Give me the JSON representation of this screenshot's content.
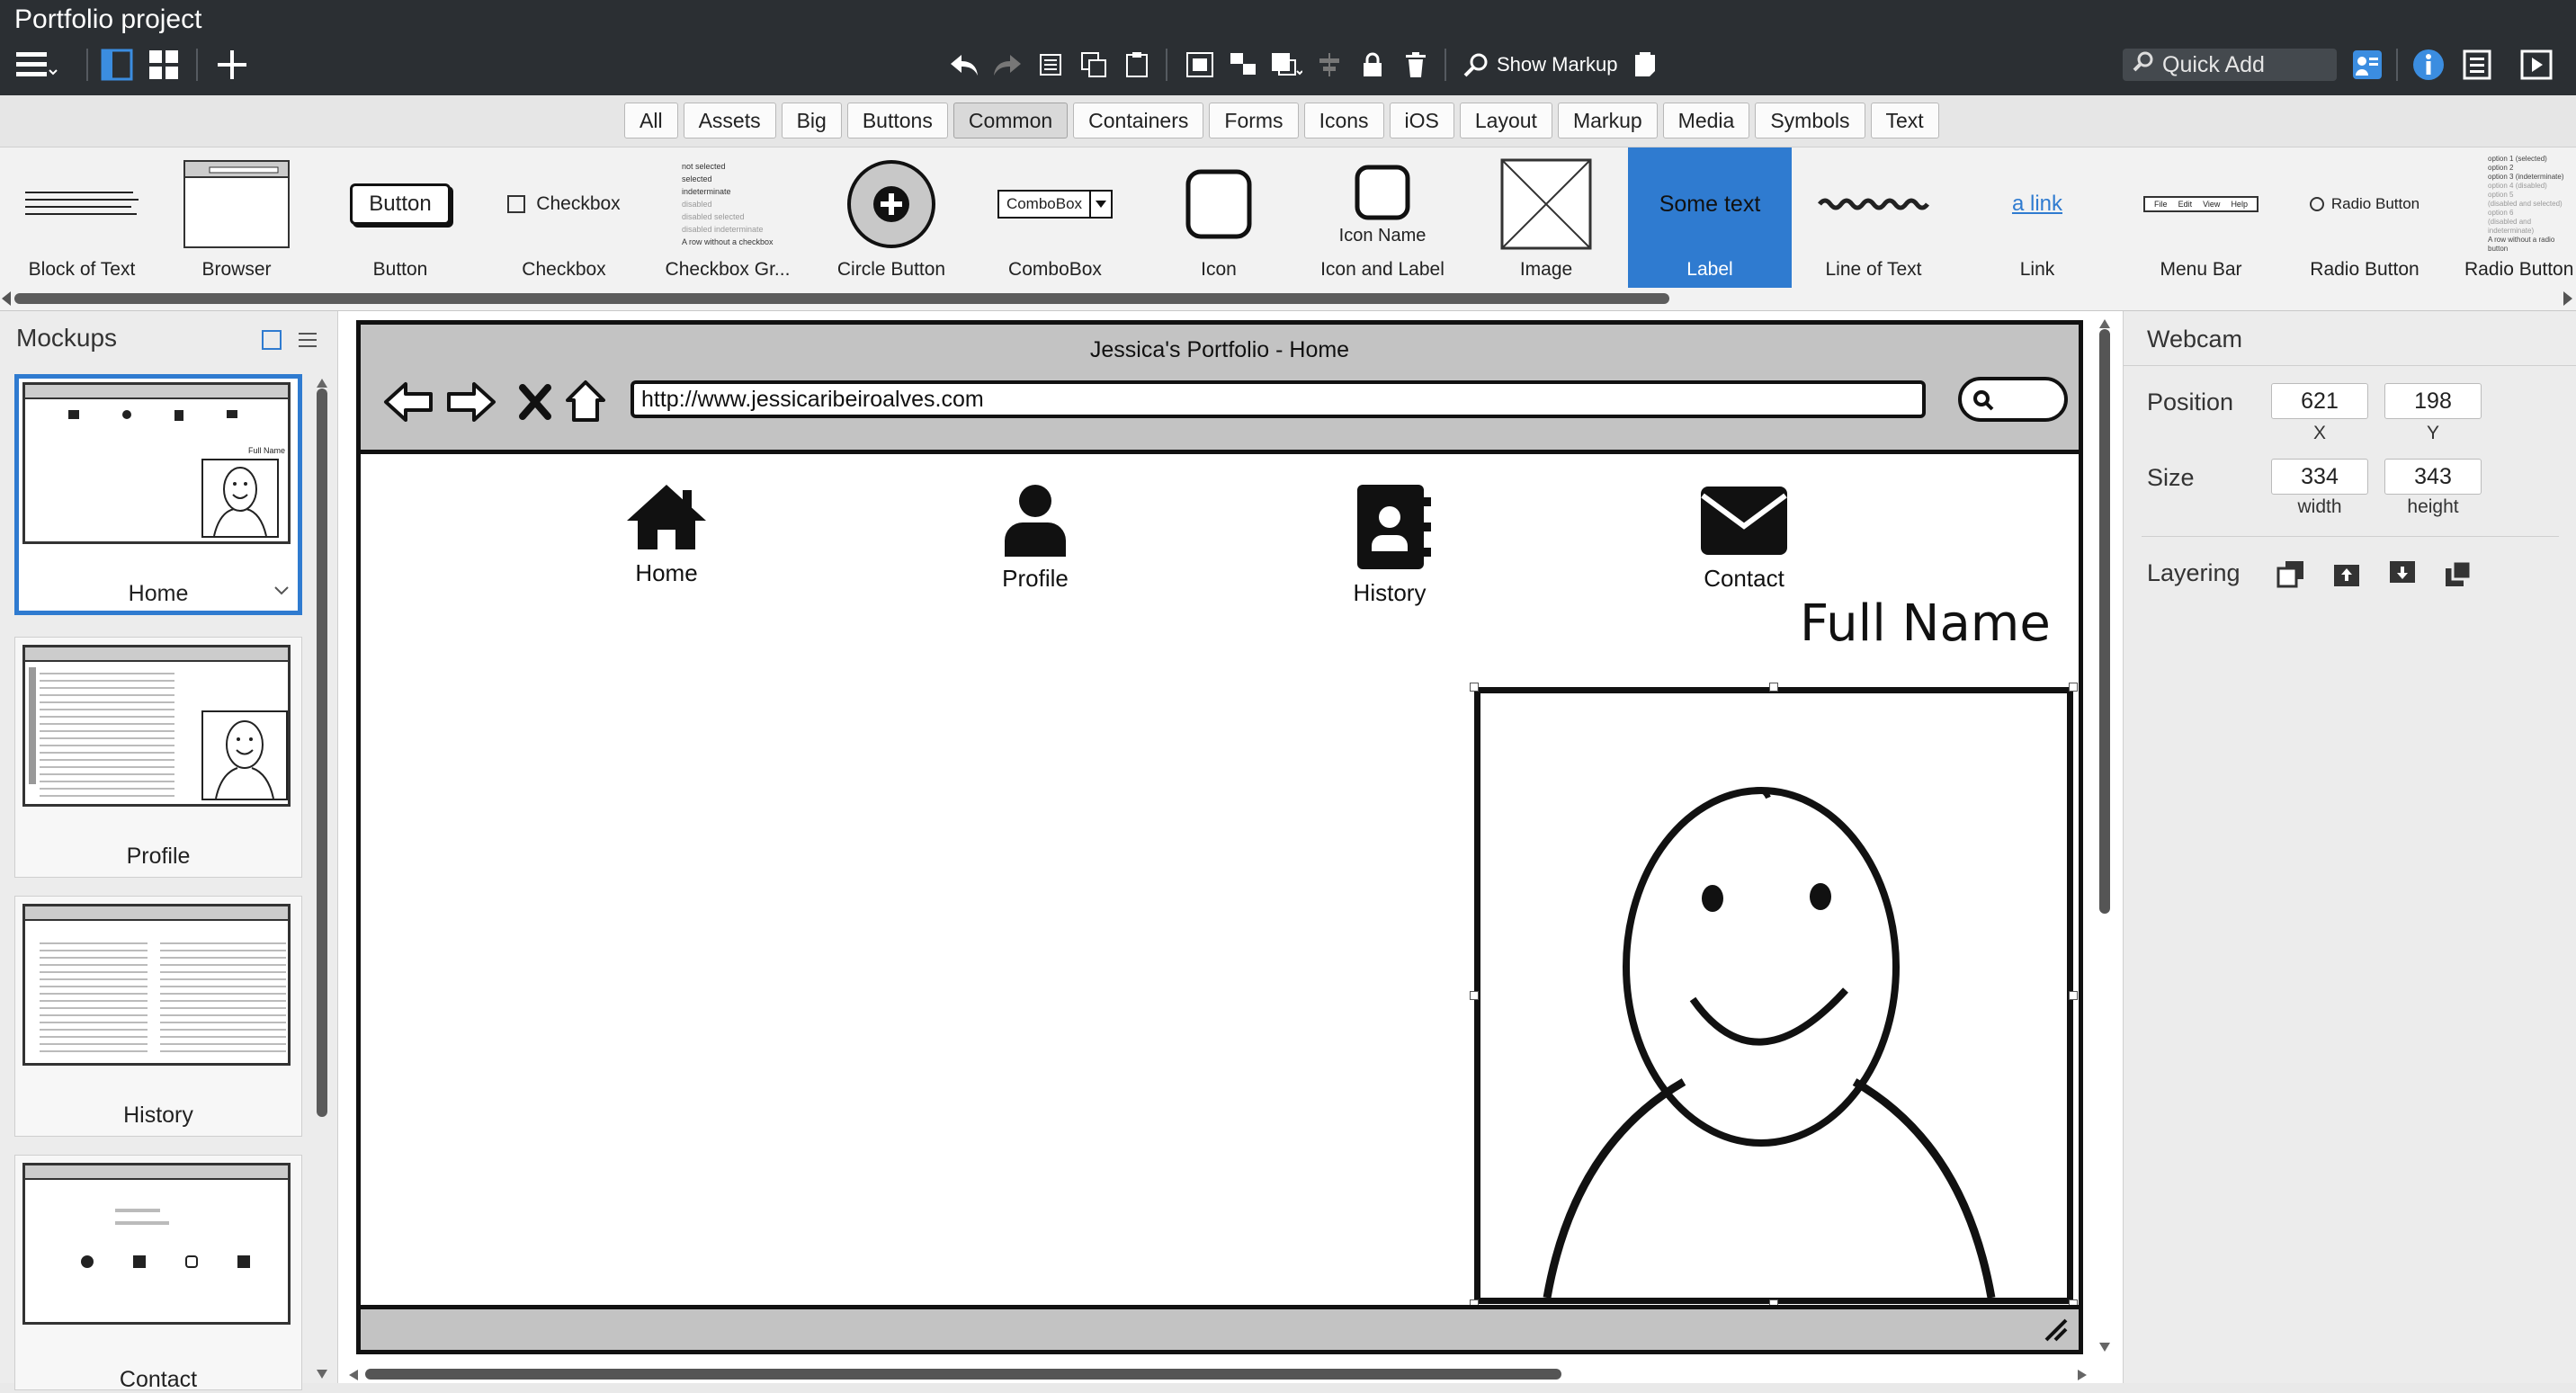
{
  "app": {
    "title": "Portfolio project"
  },
  "toolbar": {
    "show_markup": "Show Markup",
    "quick_add": "Quick Add"
  },
  "filter_tabs": [
    "All",
    "Assets",
    "Big",
    "Buttons",
    "Common",
    "Containers",
    "Forms",
    "Icons",
    "iOS",
    "Layout",
    "Markup",
    "Media",
    "Symbols",
    "Text"
  ],
  "filter_active": "Common",
  "library": {
    "items": [
      "Block of Text",
      "Browser",
      "Button",
      "Checkbox",
      "Checkbox Gr...",
      "Circle Button",
      "ComboBox",
      "Icon",
      "Icon and Label",
      "Image",
      "Label",
      "Line of Text",
      "Link",
      "Menu Bar",
      "Radio Button",
      "Radio Button"
    ],
    "selected": "Label",
    "previews": {
      "button": "Button",
      "checkbox": "Checkbox",
      "checkbox_group": [
        "not selected",
        "selected",
        "indeterminate",
        "disabled",
        "disabled selected",
        "disabled indeterminate",
        "A row without a checkbox"
      ],
      "combobox": "ComboBox",
      "icon_name": "Icon Name",
      "label": "Some text",
      "link": "a link",
      "menu_bar": [
        "File",
        "Edit",
        "View",
        "Help"
      ],
      "radio_button": "Radio Button",
      "radio_group": [
        "option 1 (selected)",
        "option 2",
        "option 3 (indeterminate)",
        "option 4 (disabled)",
        "option 5",
        "(disabled and selected)",
        "option 6",
        "(disabled and indeterminate)",
        "A row without a radio button"
      ]
    }
  },
  "mockups": {
    "title": "Mockups",
    "items": [
      "Home",
      "Profile",
      "History",
      "Contact"
    ],
    "active": "Home",
    "thumb_text": {
      "home_name": "Full Name"
    }
  },
  "canvas": {
    "browser_title": "Jessica's Portfolio - Home",
    "url": "http://www.jessicaribeiroalves.com",
    "nav": [
      "Home",
      "Profile",
      "History",
      "Contact"
    ],
    "full_name": "Full Name"
  },
  "properties": {
    "title": "Webcam",
    "position_label": "Position",
    "x": "621",
    "y": "198",
    "x_caption": "X",
    "y_caption": "Y",
    "size_label": "Size",
    "width": "334",
    "height": "343",
    "width_caption": "width",
    "height_caption": "height",
    "layering_label": "Layering"
  },
  "colors": {
    "accent": "#2f7bd0",
    "toolbar": "#2b2f33",
    "browser_chrome": "#c3c3c3"
  }
}
